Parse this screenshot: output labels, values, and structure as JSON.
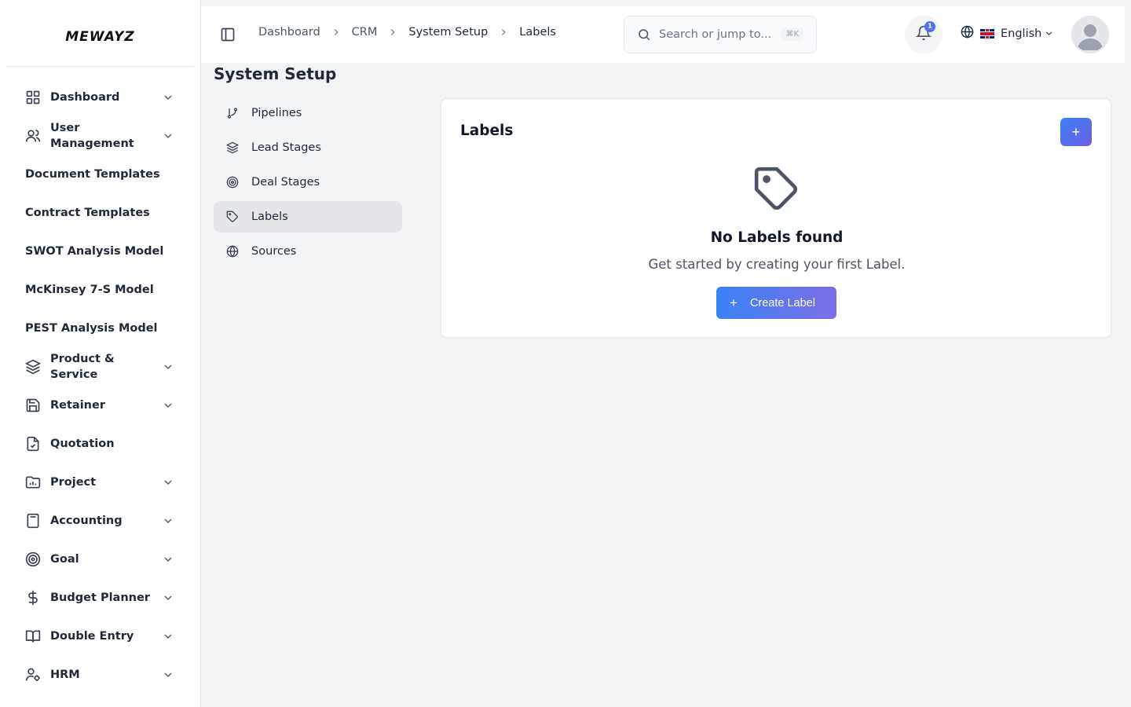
{
  "brand": {
    "logo_text": "MEWAYZ"
  },
  "sidebar": {
    "items": [
      {
        "label": "Dashboard",
        "icon": "grid-icon",
        "expandable": true
      },
      {
        "label": "User Management",
        "icon": "users-icon",
        "expandable": true
      },
      {
        "label": "Document Templates",
        "icon": "",
        "expandable": false
      },
      {
        "label": "Contract Templates",
        "icon": "",
        "expandable": false
      },
      {
        "label": "SWOT Analysis Model",
        "icon": "",
        "expandable": false
      },
      {
        "label": "McKinsey 7-S Model",
        "icon": "",
        "expandable": false
      },
      {
        "label": "PEST Analysis Model",
        "icon": "",
        "expandable": false
      },
      {
        "label": "Product & Service",
        "icon": "layers-icon",
        "expandable": true
      },
      {
        "label": "Retainer",
        "icon": "save-icon",
        "expandable": true
      },
      {
        "label": "Quotation",
        "icon": "file-check-icon",
        "expandable": false
      },
      {
        "label": "Project",
        "icon": "folder-chart-icon",
        "expandable": true
      },
      {
        "label": "Accounting",
        "icon": "calculator-icon",
        "expandable": true
      },
      {
        "label": "Goal",
        "icon": "target-icon",
        "expandable": true
      },
      {
        "label": "Budget Planner",
        "icon": "dollar-icon",
        "expandable": true
      },
      {
        "label": "Double Entry",
        "icon": "book-open-icon",
        "expandable": true
      },
      {
        "label": "HRM",
        "icon": "user-cog-icon",
        "expandable": true
      }
    ]
  },
  "header": {
    "breadcrumb": [
      "Dashboard",
      "CRM",
      "System Setup",
      "Labels"
    ],
    "search": {
      "placeholder": "Search or jump to...",
      "shortcut": "⌘K"
    },
    "notifications": {
      "count": "1"
    },
    "language": {
      "label": "English",
      "flag": "uk-flag"
    }
  },
  "page": {
    "title": "System Setup",
    "subnav": [
      {
        "label": "Pipelines",
        "icon": "git-branch-icon",
        "active": false
      },
      {
        "label": "Lead Stages",
        "icon": "layers-icon",
        "active": false
      },
      {
        "label": "Deal Stages",
        "icon": "target-icon",
        "active": false
      },
      {
        "label": "Labels",
        "icon": "tag-icon",
        "active": true
      },
      {
        "label": "Sources",
        "icon": "globe-icon",
        "active": false
      }
    ],
    "card": {
      "title": "Labels",
      "add_label": "+",
      "empty_title": "No Labels found",
      "empty_subtitle": "Get started by creating your first Label.",
      "create_label": "Create Label",
      "create_plus": "+"
    }
  },
  "colors": {
    "accent_start": "#3b82f6",
    "accent_end": "#7c6ee6",
    "active_bg": "#e5e7eb"
  }
}
